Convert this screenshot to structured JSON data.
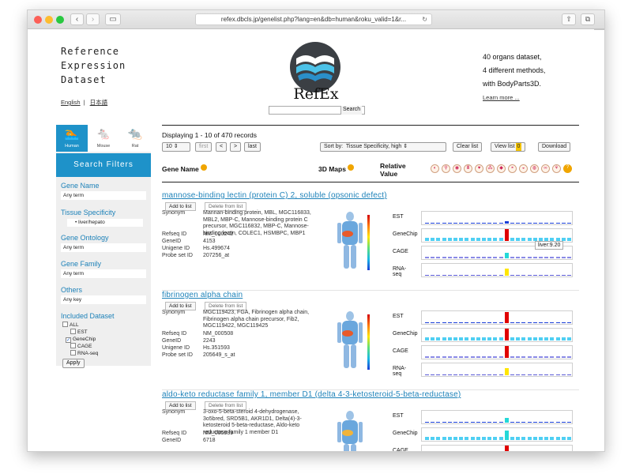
{
  "browser": {
    "url": "refex.dbcls.jp/genelist.php?lang=en&db=human&roku_valid=1&r...",
    "plus_icon": "plus-icon"
  },
  "header": {
    "title_lines": [
      "Reference",
      "Expression",
      "Dataset"
    ],
    "lang_english": "English",
    "lang_japanese": "日本語",
    "logo_text": "RefEx",
    "search_button": "Search",
    "info_lines": [
      "40 organs dataset,",
      "4 different methods,",
      "with BodyParts3D."
    ],
    "learn_more": "Learn more ..."
  },
  "sidebar": {
    "species": [
      {
        "label": "Human",
        "icon": "human-icon"
      },
      {
        "label": "Mouse",
        "icon": "mouse-icon"
      },
      {
        "label": "Rat",
        "icon": "rat-icon"
      }
    ],
    "filters_title": "Search Filters",
    "gene_name_label": "Gene Name",
    "gene_name_value": "Any term",
    "tissue_label": "Tissue Specificity",
    "tissue_value": "liver/hepato",
    "ontology_label": "Gene Ontology",
    "ontology_value": "Any term",
    "family_label": "Gene Family",
    "family_value": "Any term",
    "others_label": "Others",
    "others_value": "Any key",
    "dataset_label": "Included Dataset",
    "datasets": [
      {
        "label": "ALL",
        "checked": false
      },
      {
        "label": "EST",
        "checked": false
      },
      {
        "label": "GeneChip",
        "checked": true
      },
      {
        "label": "CAGE",
        "checked": false
      },
      {
        "label": "RNA-seq",
        "checked": false
      }
    ],
    "apply_label": "Apply"
  },
  "main": {
    "displaying": "Displaying 1 - 10 of 470 records",
    "per_page": "10",
    "first": "first",
    "prev": "<",
    "next": ">",
    "last": "last",
    "sort_label": "Sort by:",
    "sort_value": "Tissue Specificity, high",
    "clear_list": "Clear list",
    "view_list": "View list",
    "view_list_count": "0",
    "download": "Download",
    "col_gene_name": "Gene Name",
    "col_3d_maps": "3D Maps",
    "col_relative_value": "Relative\nValue",
    "organ_icons": [
      "brain-icon",
      "spinal-cord-icon",
      "eye-icon",
      "thyroid-icon",
      "heart-icon",
      "lung-icon",
      "liver-icon",
      "stomach-icon",
      "pancreas-icon",
      "kidney-icon",
      "intestine-icon",
      "muscle-icon",
      "help-icon"
    ],
    "add_label": "Add to list",
    "delete_label": "Delete from list",
    "meta_keys": [
      "Synonym",
      "Refseq ID",
      "GeneID",
      "Unigene ID",
      "Probe set ID"
    ],
    "track_names": [
      "EST",
      "GeneChip",
      "CAGE",
      "RNA-seq"
    ],
    "genes": [
      {
        "title": "mannose-binding lectin (protein C) 2, soluble (opsonic defect)",
        "synonym": "Mannan-binding protein, MBL, MGC116833, MBL2, MBP-C, Mannose-binding protein C precursor, MGC116832, MBP-C, Mannose-binding lectin, COLEC1, HSMBPC, MBP1",
        "refseq": "NM_000242",
        "geneid": "4153",
        "unigene": "Hs.499674",
        "probe": "207256_at",
        "tooltip": "liver:9.20"
      },
      {
        "title": "fibrinogen alpha chain",
        "synonym": "MGC119423, FGA, Fibrinogen alpha chain, Fibrinogen alpha chain precursor, Fib2, MGC119422, MGC119425",
        "refseq": "NM_000508",
        "geneid": "2243",
        "unigene": "Hs.351593",
        "probe": "205649_s_at"
      },
      {
        "title": "aldo-keto reductase family 1, member D1 (delta 4-3-ketosteroid-5-beta-reductase)",
        "synonym": "3-oxo-5-beta-steroid 4-dehydrogenase, 3o5bred, SRD5B1, AKR1D1, Delta(4)-3-ketosteroid 5-beta-reductase, Aldo-keto reductase family 1 member D1",
        "refseq": "NM_005989",
        "geneid": "6718"
      }
    ]
  }
}
